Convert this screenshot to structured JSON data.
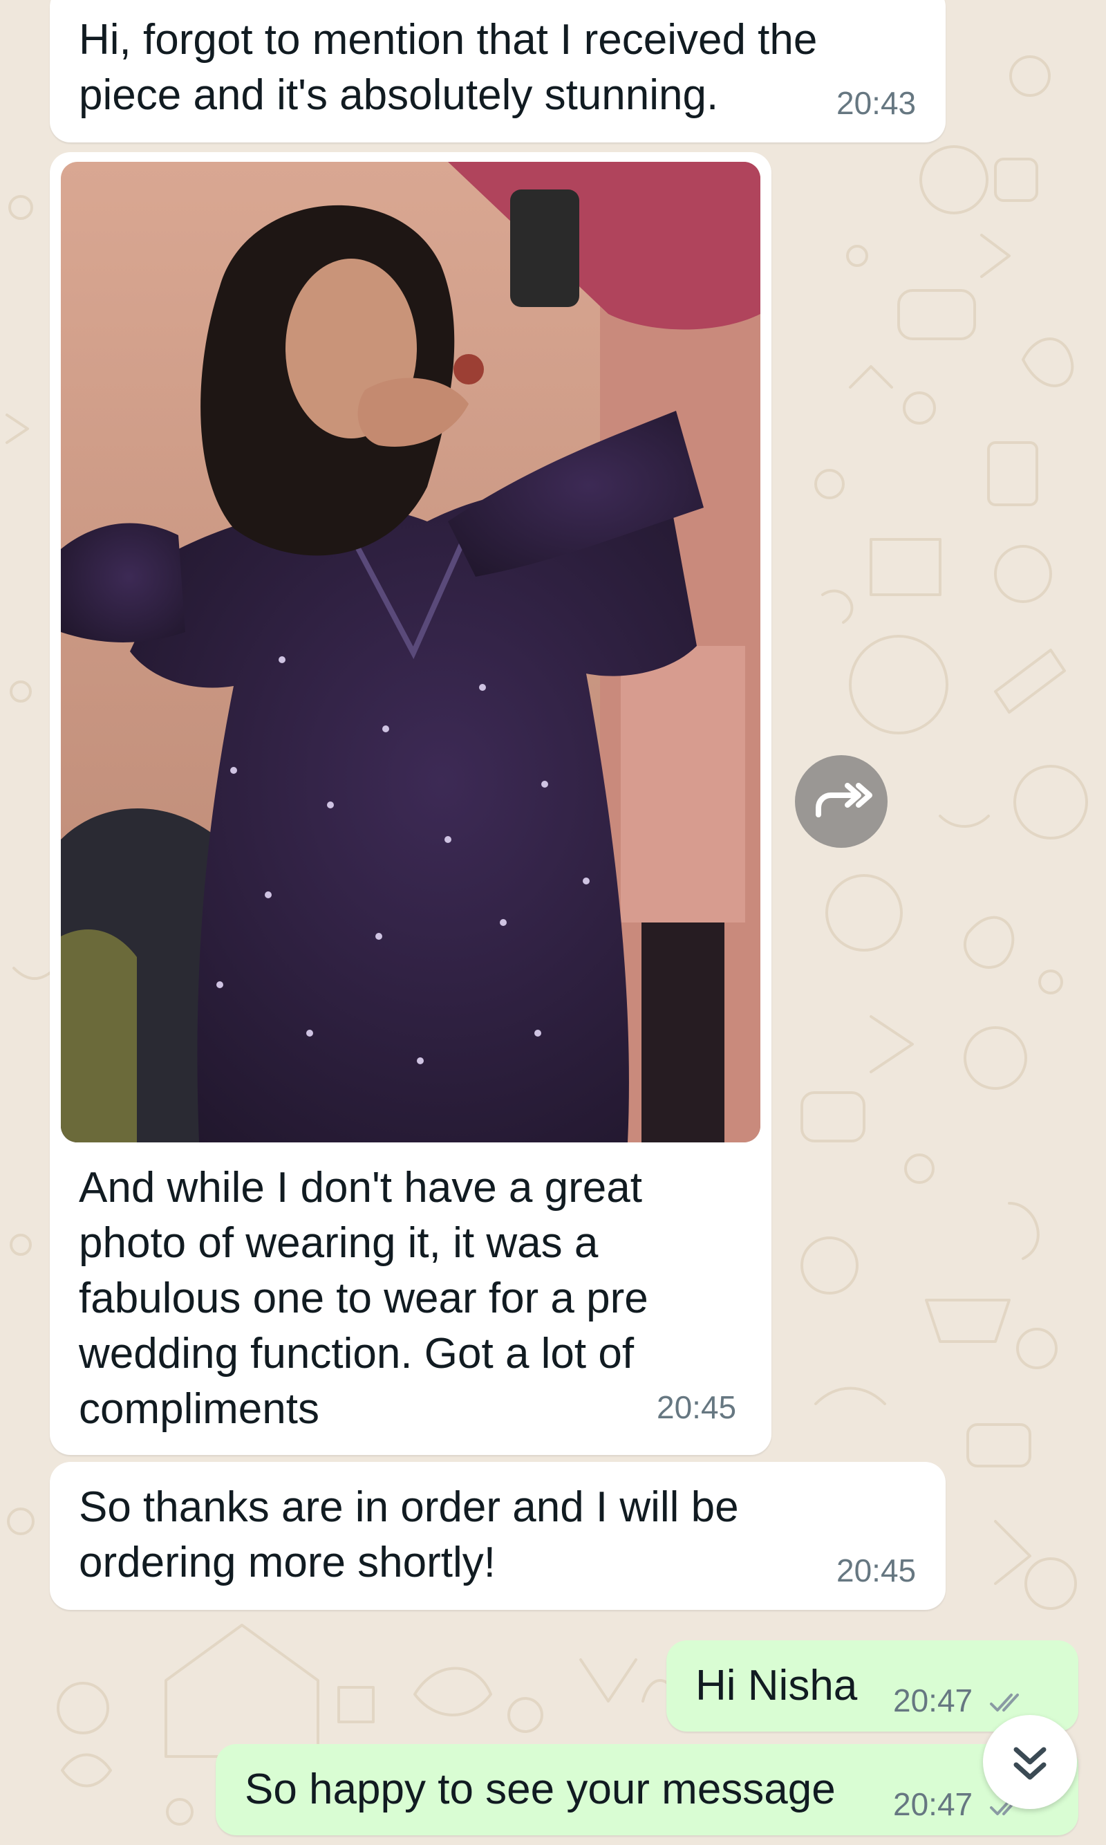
{
  "chat": {
    "messages": [
      {
        "direction": "incoming",
        "text": "Hi, forgot to mention that I received the\npiece and it's absolutely stunning.",
        "time": "20:43"
      },
      {
        "direction": "incoming",
        "type": "image",
        "caption": "And while I don't have a great\nphoto of wearing it, it was a\nfabulous one to wear for a pre\nwedding function. Got a lot of\ncompliments",
        "time": "20:45"
      },
      {
        "direction": "incoming",
        "text": "So thanks are in order and I will be\nordering more shortly!",
        "time": "20:45"
      },
      {
        "direction": "outgoing",
        "text": "Hi Nisha",
        "time": "20:47",
        "status": "delivered"
      },
      {
        "direction": "outgoing",
        "text": "So happy to see your message",
        "time": "20:47",
        "status": "delivered"
      }
    ]
  },
  "icons": {
    "forward": "forward-icon",
    "scroll_down": "double-chevron-down-icon",
    "ticks": "double-tick-icon"
  },
  "colors": {
    "wallpaper": "#efe7dc",
    "incoming_bubble": "#ffffff",
    "outgoing_bubble": "#d9fdd3",
    "timestamp": "#667781",
    "tick": "#8a9aa3"
  }
}
